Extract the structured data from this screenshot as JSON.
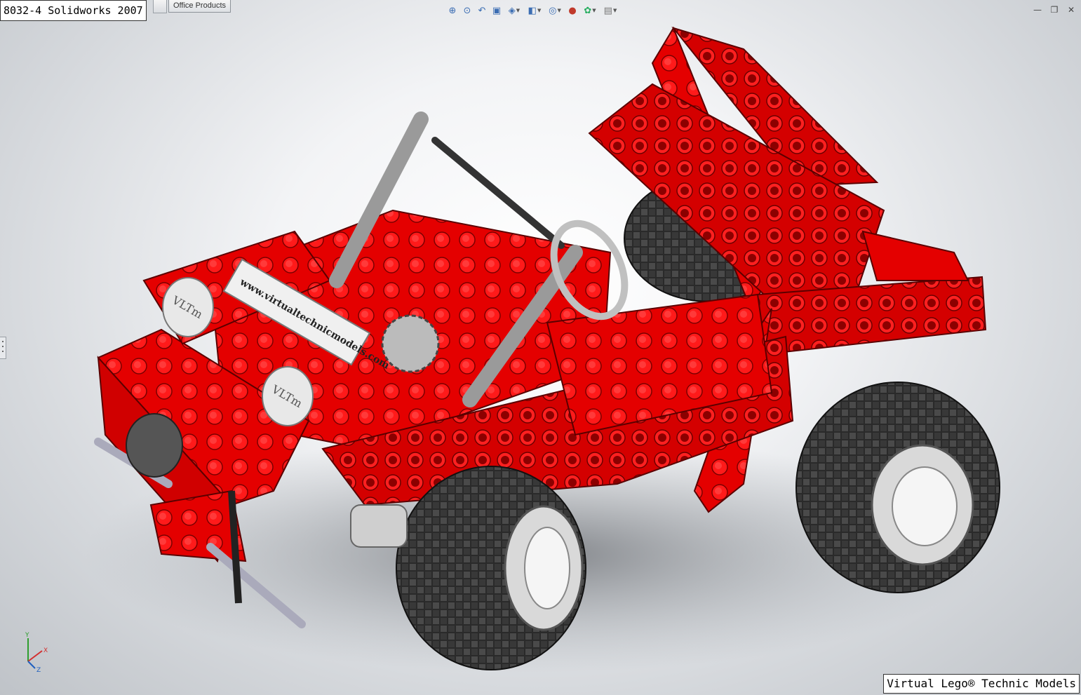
{
  "title": "8032-4 Solidworks 2007",
  "tabs": [
    {
      "label": "Office Products"
    }
  ],
  "heads_up_toolbar": [
    {
      "icon": "zoom-to-fit-icon"
    },
    {
      "icon": "zoom-to-area-icon"
    },
    {
      "icon": "previous-view-icon"
    },
    {
      "icon": "section-view-icon"
    },
    {
      "icon": "view-orientation-icon",
      "dropdown": true
    },
    {
      "icon": "display-style-icon",
      "dropdown": true
    },
    {
      "icon": "hide-show-items-icon",
      "dropdown": true
    },
    {
      "icon": "edit-appearance-icon"
    },
    {
      "icon": "apply-scene-icon",
      "dropdown": true
    },
    {
      "icon": "view-settings-icon",
      "dropdown": true
    }
  ],
  "window_controls": [
    {
      "icon": "minimize-icon",
      "glyph": "—"
    },
    {
      "icon": "restore-icon",
      "glyph": "❐"
    },
    {
      "icon": "close-icon",
      "glyph": "✕"
    }
  ],
  "triad": {
    "x": "X",
    "y": "Y",
    "z": "Z"
  },
  "footer": "Virtual Lego® Technic Models",
  "model": {
    "decals": [
      "VLTm",
      "VLTm",
      "www.virtualtechnicmodels.com"
    ],
    "colors": {
      "brick": "#e40000",
      "brick_dark": "#8c0000",
      "tire": "#2a2a2a",
      "rim": "#e8e8e8",
      "grey_part": "#b8b8b8"
    }
  }
}
